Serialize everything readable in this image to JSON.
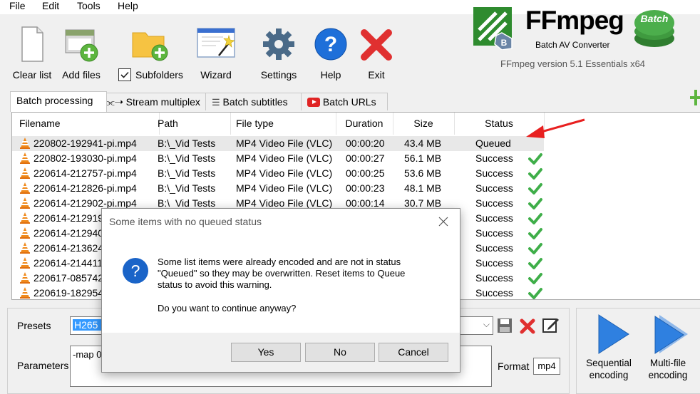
{
  "menu": [
    "File",
    "Edit",
    "Tools",
    "Help"
  ],
  "toolbar": {
    "clear_list": "Clear list",
    "add_files": "Add files",
    "subfolders": "Subfolders",
    "wizard": "Wizard",
    "settings": "Settings",
    "help": "Help",
    "exit": "Exit"
  },
  "brand": {
    "name": "FFmpeg",
    "subtitle": "Batch AV Converter",
    "badge": "Batch",
    "version": "FFmpeg version 5.1 Essentials  x64"
  },
  "tabs": [
    "Batch processing",
    "Stream multiplex",
    "Batch subtitles",
    "Batch URLs"
  ],
  "table": {
    "columns": [
      "Filename",
      "Path",
      "File type",
      "Duration",
      "Size",
      "Status"
    ],
    "rows": [
      [
        "220802-192941-pi.mp4",
        "B:\\_Vid Tests",
        "MP4 Video File (VLC)",
        "00:00:20",
        "43.4 MB",
        "Queued"
      ],
      [
        "220802-193030-pi.mp4",
        "B:\\_Vid Tests",
        "MP4 Video File (VLC)",
        "00:00:27",
        "56.1 MB",
        "Success"
      ],
      [
        "220614-212757-pi.mp4",
        "B:\\_Vid Tests",
        "MP4 Video File (VLC)",
        "00:00:25",
        "53.6 MB",
        "Success"
      ],
      [
        "220614-212826-pi.mp4",
        "B:\\_Vid Tests",
        "MP4 Video File (VLC)",
        "00:00:23",
        "48.1 MB",
        "Success"
      ],
      [
        "220614-212902-pi.mp4",
        "B:\\_Vid Tests",
        "MP4 Video File (VLC)",
        "00:00:14",
        "30.7 MB",
        "Success"
      ],
      [
        "220614-212919",
        "",
        "",
        "",
        "",
        "Success"
      ],
      [
        "220614-212940",
        "",
        "",
        "",
        "",
        "Success"
      ],
      [
        "220614-213624",
        "",
        "",
        "",
        "",
        "Success"
      ],
      [
        "220614-214411",
        "",
        "",
        "",
        "",
        "Success"
      ],
      [
        "220617-085742",
        "",
        "",
        "",
        "",
        "Success"
      ],
      [
        "220619-182954",
        "",
        "",
        "",
        "",
        "Success"
      ]
    ]
  },
  "presets": {
    "label": "Presets",
    "value": "H265 c",
    "parameters_label": "Parameters",
    "parameters_value": "-map 0",
    "format_label": "Format",
    "format_value": "mp4"
  },
  "encode": {
    "sequential": [
      "Sequential",
      "encoding"
    ],
    "multifile": [
      "Multi-file",
      "encoding"
    ]
  },
  "dialog": {
    "title": "Some items with no queued status",
    "message_lines": [
      "Some list items were already encoded and are not in status",
      "\"Queued\" so they may be overwritten. Reset items to Queue",
      "status to avoid this warning."
    ],
    "question": "Do you want to continue anyway?",
    "yes": "Yes",
    "no": "No",
    "cancel": "Cancel"
  },
  "colors": {
    "accent_blue": "#1e6fd9",
    "success_green": "#3fae49",
    "error_red": "#e03030",
    "selection": "#3399ff"
  }
}
